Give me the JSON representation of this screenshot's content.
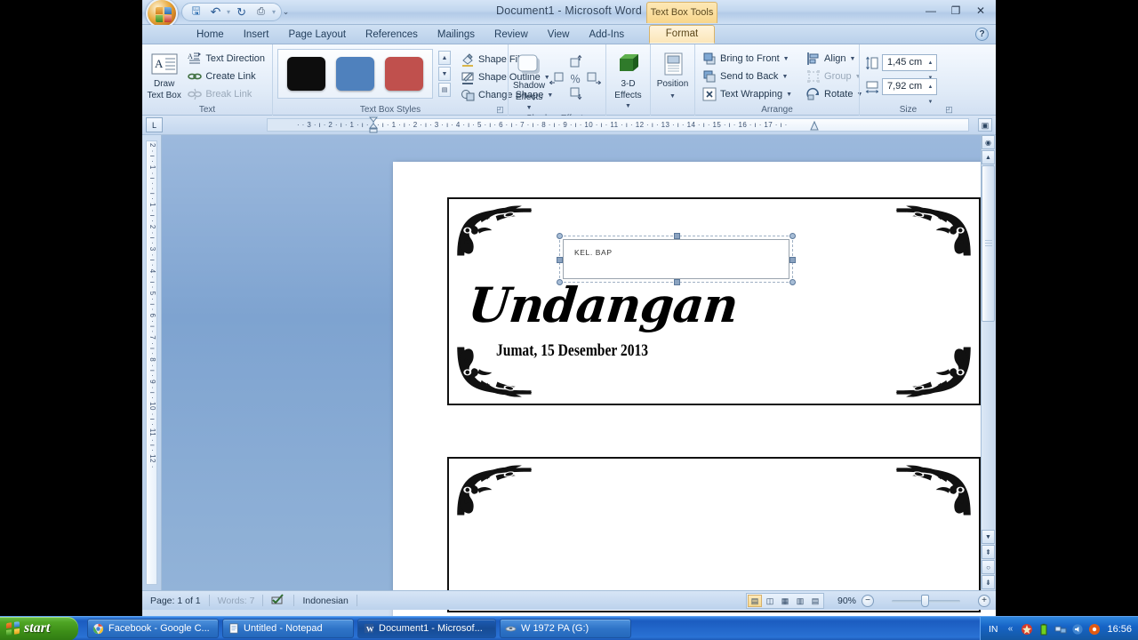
{
  "window": {
    "title": "Document1 - Microsoft Word",
    "contextual_tool": "Text Box Tools",
    "minimize": "—",
    "maximize": "❐",
    "close": "✕",
    "help": "?"
  },
  "quick_access": {
    "office_button": "office-orb",
    "items": [
      {
        "name": "save",
        "glyph": "💾"
      },
      {
        "name": "undo",
        "glyph": "↶"
      },
      {
        "name": "undo-dropdown",
        "glyph": "▾"
      },
      {
        "name": "redo",
        "glyph": "↻"
      },
      {
        "name": "print-preview",
        "glyph": "🖶"
      },
      {
        "name": "print-preview-dropdown",
        "glyph": "▾"
      }
    ],
    "customize": "⌄"
  },
  "tabs": [
    {
      "label": "Home"
    },
    {
      "label": "Insert"
    },
    {
      "label": "Page Layout"
    },
    {
      "label": "References"
    },
    {
      "label": "Mailings"
    },
    {
      "label": "Review"
    },
    {
      "label": "View"
    },
    {
      "label": "Add-Ins"
    }
  ],
  "active_tab": "Format",
  "ribbon": {
    "groups": [
      {
        "title": "Text",
        "big_button": {
          "line1": "Draw",
          "line2": "Text Box",
          "icon": "A"
        },
        "items": [
          {
            "label": "Text Direction",
            "disabled": false,
            "caret": false
          },
          {
            "label": "Create Link",
            "disabled": false,
            "caret": false
          },
          {
            "label": "Break Link",
            "disabled": true,
            "caret": false
          }
        ]
      },
      {
        "title": "Text Box Styles",
        "swatches": [
          "#0d0d0d",
          "#4f81bd",
          "#c0504d"
        ],
        "scroll": [
          "▲",
          "▼",
          "▤"
        ],
        "items": [
          {
            "label": "Shape Fill",
            "disabled": false,
            "caret": true
          },
          {
            "label": "Shape Outline",
            "disabled": false,
            "caret": true
          },
          {
            "label": "Change Shape",
            "disabled": false,
            "caret": true
          }
        ],
        "launcher": "◰"
      },
      {
        "title": "Shadow Effects",
        "big_button": {
          "line1": "Shadow",
          "line2": "Effects",
          "caret": true
        },
        "nudge": [
          "",
          "↑",
          "",
          "←",
          "%",
          "→",
          "",
          "↓",
          ""
        ]
      },
      {
        "title": "",
        "big_button": {
          "line1": "3-D",
          "line2": "Effects",
          "caret": true
        }
      },
      {
        "title": "",
        "big_button": {
          "line1": "Position",
          "line2": "",
          "caret": true
        }
      },
      {
        "title": "Arrange",
        "items": [
          {
            "label": "Bring to Front",
            "disabled": false,
            "caret": true
          },
          {
            "label": "Send to Back",
            "disabled": false,
            "caret": true
          },
          {
            "label": "Text Wrapping",
            "disabled": false,
            "caret": true
          },
          {
            "label": "Align",
            "disabled": false,
            "caret": true
          },
          {
            "label": "Group",
            "disabled": true,
            "caret": true
          },
          {
            "label": "Rotate",
            "disabled": false,
            "caret": true
          }
        ]
      },
      {
        "title": "Size",
        "fields": [
          {
            "name": "shape-height",
            "value": "1,45 cm"
          },
          {
            "name": "shape-width",
            "value": "7,92 cm"
          }
        ],
        "launcher": "◰"
      }
    ]
  },
  "ruler": {
    "tab_selector": "L",
    "horizontal_left": "·  ·  3  ·  ı  ·  2  ·  ı  ·  1  ·  ı  ·",
    "horizontal_right": "·  ı  ·  1  ·  ı  ·  2  ·  ı  ·  3  ·  ı  ·  4  ·  ı  ·  5  ·  ı  ·  6  ·  ı  ·  7  ·  ı  ·  8  ·  ı  ·  9  ·  ı  · 10 ·  ı  · 11 ·  ı  · 12 ·  ı  · 13 ·  ı  · 14 ·  ı  · 15 ·  ı  · 16 ·  ı  · 17 ·  ı  ·",
    "vertical": "2 · ı · 1 · ı · · ı · 1 · ı · 2 · ı · 3 · ı · 4 · ı · 5 · ı · 6 · ı · 7 · ı · 8 · ı · 9 · ı · 10 · ı · 11 · ı · 12 ·",
    "show_ruler_button": "▣"
  },
  "document": {
    "card1": {
      "text_box": {
        "value": "KEL. BAP",
        "selected": true
      },
      "title": "Undangan",
      "date": "Jumat, 15 Desember 2013"
    },
    "card2": {}
  },
  "scrollbar": {
    "select_browse_object": "◉",
    "up": "▲",
    "down": "▼",
    "prev_page": "⇞",
    "browse": "○",
    "next_page": "⇟"
  },
  "status_bar": {
    "page": "Page: 1 of 1",
    "words": "Words: 7",
    "proofing_icon": "proofing-errors-icon",
    "language": "Indonesian",
    "views": [
      {
        "name": "print-layout",
        "glyph": "▤",
        "active": true
      },
      {
        "name": "full-screen-reading",
        "glyph": "◫",
        "active": false
      },
      {
        "name": "web-layout",
        "glyph": "▦",
        "active": false
      },
      {
        "name": "outline",
        "glyph": "▥",
        "active": false
      },
      {
        "name": "draft",
        "glyph": "▤",
        "active": false
      }
    ],
    "zoom": "90%",
    "zoom_out": "−",
    "zoom_in": "+"
  },
  "taskbar": {
    "start": "start",
    "buttons": [
      {
        "label": "Facebook - Google C...",
        "icon": "chrome-icon",
        "active": false
      },
      {
        "label": "Untitled - Notepad",
        "icon": "notepad-icon",
        "active": false
      },
      {
        "label": "Document1 - Microsof...",
        "icon": "word-icon",
        "active": true
      },
      {
        "label": "W 1972 PA (G:)",
        "icon": "drive-icon",
        "active": false
      }
    ],
    "ime": "IN",
    "tray": [
      {
        "name": "show-hidden-icons",
        "glyph": "«"
      },
      {
        "name": "antivirus-icon",
        "glyph": "✹"
      },
      {
        "name": "battery-icon",
        "glyph": "▮"
      },
      {
        "name": "network-icon",
        "glyph": "⇅"
      },
      {
        "name": "audio-icon",
        "glyph": "♪"
      },
      {
        "name": "media-icon",
        "glyph": "◉"
      }
    ],
    "clock": "16:56"
  }
}
